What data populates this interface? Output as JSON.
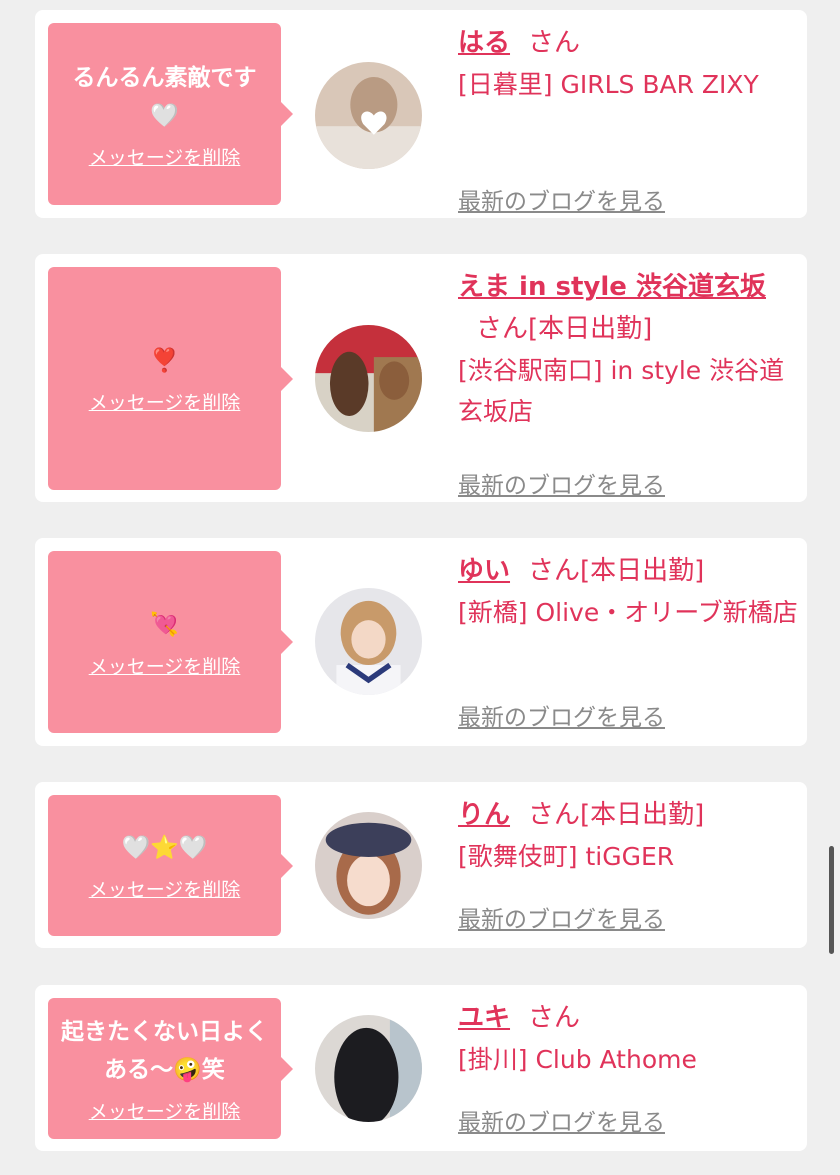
{
  "cards": [
    {
      "message": "るんるん素敵です\n🤍",
      "delete_label": "メッセージを削除",
      "name": "はる",
      "suffix": "さん",
      "shop": "[日暮里] GIRLS BAR ZIXY",
      "blog_label": "最新のブログを見る",
      "avatar_icon": "photo-avatar-icon"
    },
    {
      "message": "❣️",
      "delete_label": "メッセージを削除",
      "name": "えま in style 渋谷道玄坂",
      "suffix": "さん[本日出勤]",
      "shop": "[渋谷駅南口] in style 渋谷道玄坂店",
      "blog_label": "最新のブログを見る",
      "avatar_icon": "photo-avatar-icon"
    },
    {
      "message": "💘",
      "delete_label": "メッセージを削除",
      "name": "ゆい",
      "suffix": "さん[本日出勤]",
      "shop": "[新橋] Olive・オリーブ新橋店",
      "blog_label": "最新のブログを見る",
      "avatar_icon": "photo-avatar-icon"
    },
    {
      "message": "🤍⭐🤍",
      "delete_label": "メッセージを削除",
      "name": "りん",
      "suffix": "さん[本日出勤]",
      "shop": "[歌舞伎町] tiGGER",
      "blog_label": "最新のブログを見る",
      "avatar_icon": "photo-avatar-icon"
    },
    {
      "message": "起きたくない日よくある〜🤪笑",
      "delete_label": "メッセージを削除",
      "name": "ユキ",
      "suffix": "さん",
      "shop": "[掛川] Club Athome",
      "blog_label": "最新のブログを見る",
      "avatar_icon": "photo-avatar-icon"
    }
  ],
  "colors": {
    "accent": "#e0335a",
    "bubble": "#f9909f",
    "background": "#efefef"
  }
}
